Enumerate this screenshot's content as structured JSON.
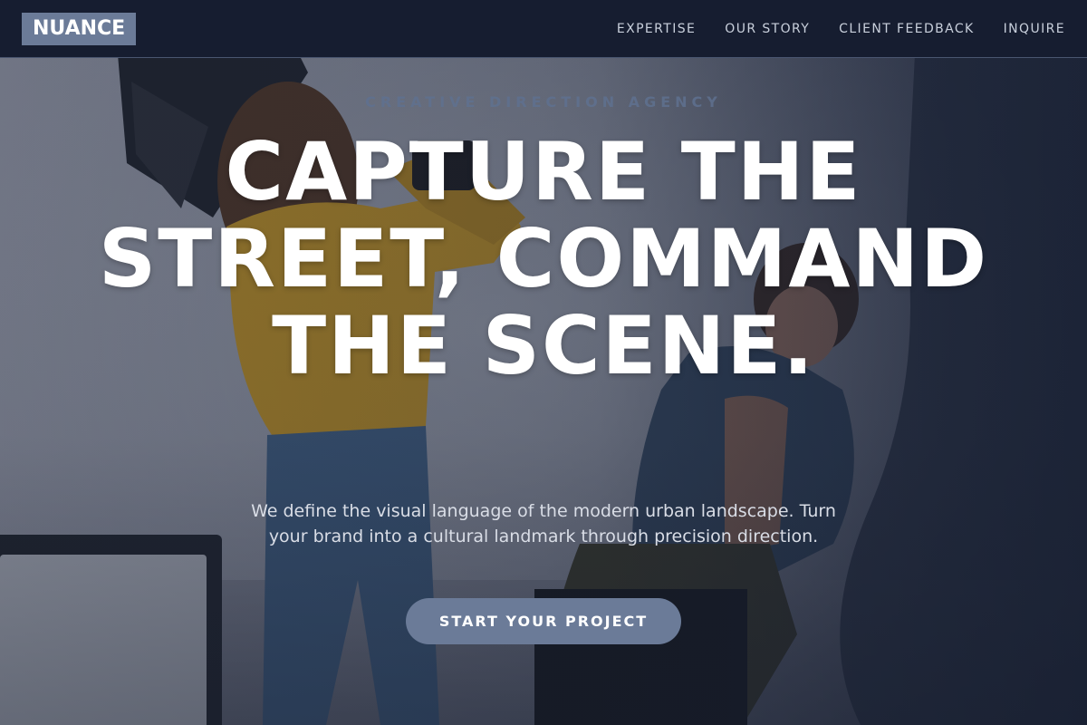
{
  "header": {
    "brand": "NUANCE",
    "nav": [
      {
        "label": "EXPERTISE"
      },
      {
        "label": "OUR STORY"
      },
      {
        "label": "CLIENT FEEDBACK"
      },
      {
        "label": "INQUIRE"
      }
    ]
  },
  "hero": {
    "eyebrow": "CREATIVE DIRECTION AGENCY",
    "headline": "CAPTURE THE STREET, COMMAND THE SCENE.",
    "subtext": "We define the visual language of the modern urban landscape. Turn your brand into a cultural landmark through precision direction.",
    "cta_label": "START YOUR PROJECT",
    "background_image": "photo-studio-shoot-image"
  },
  "colors": {
    "nav_background": "#161d30",
    "brand_background": "#6b7b98",
    "cta_background": "#6b7b98",
    "nav_text": "#c9d0dc",
    "eyebrow_text": "#5f7190",
    "headline_text": "#ffffff"
  }
}
